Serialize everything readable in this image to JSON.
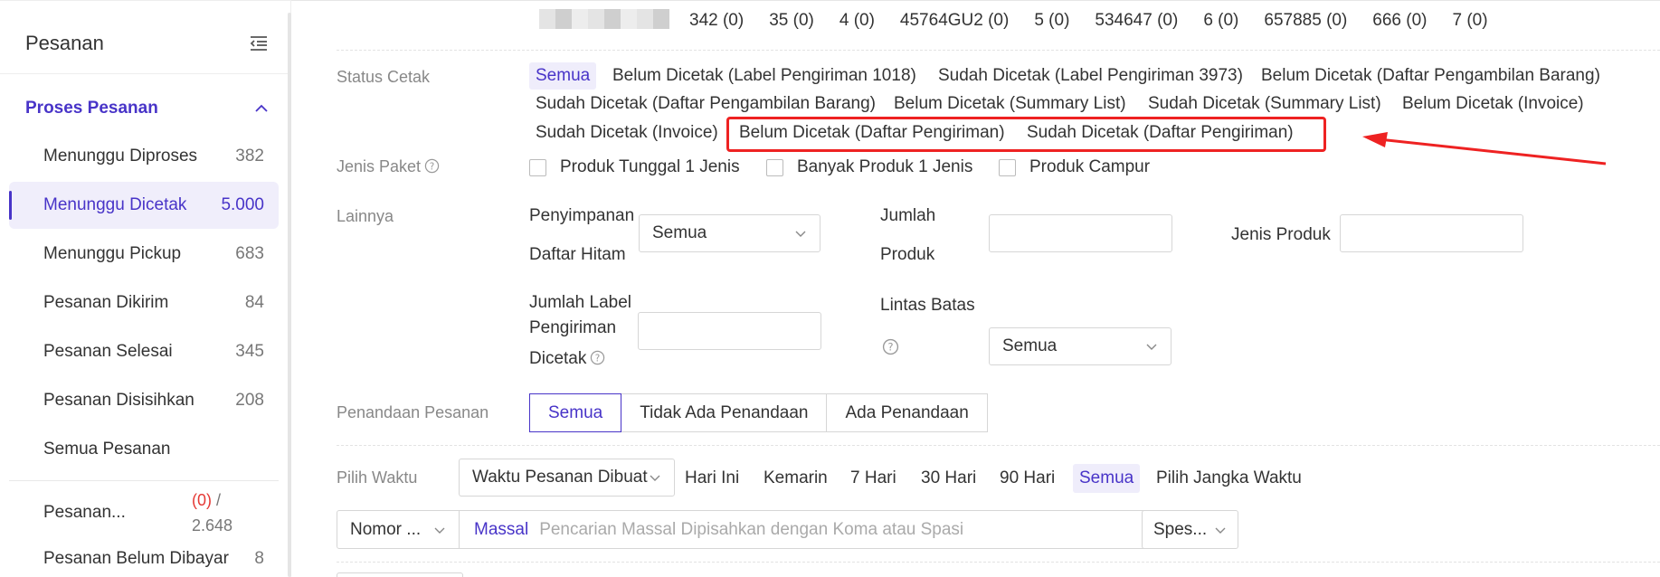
{
  "sidebar": {
    "title": "Pesanan",
    "group_label": "Proses Pesanan",
    "items": [
      {
        "label": "Menunggu Diproses",
        "count": "382"
      },
      {
        "label": "Menunggu Dicetak",
        "count": "5.000"
      },
      {
        "label": "Menunggu Pickup",
        "count": "683"
      },
      {
        "label": "Pesanan Dikirim",
        "count": "84"
      },
      {
        "label": "Pesanan Selesai",
        "count": "345"
      },
      {
        "label": "Pesanan Disisihkan",
        "count": "208"
      },
      {
        "label": "Semua Pesanan",
        "count": ""
      }
    ],
    "extra": {
      "label": "Pesanan...",
      "count_red": "(0)",
      "count_sep": " /",
      "count_total": "2.648"
    },
    "last": {
      "label": "Pesanan Belum Dibayar",
      "count": "8"
    }
  },
  "top_counts": [
    "342 (0)",
    "35 (0)",
    "4 (0)",
    "45764GU2 (0)",
    "5 (0)",
    "534647 (0)",
    "6 (0)",
    "657885 (0)",
    "666 (0)",
    "7 (0)"
  ],
  "status_cetak": {
    "label": "Status Cetak",
    "options": [
      "Semua",
      "Belum Dicetak (Label Pengiriman 1018)",
      "Sudah Dicetak (Label Pengiriman 3973)",
      "Belum Dicetak (Daftar Pengambilan Barang)",
      "Sudah Dicetak (Daftar Pengambilan Barang)",
      "Belum Dicetak (Summary List)",
      "Sudah Dicetak (Summary List)",
      "Belum Dicetak (Invoice)",
      "Sudah Dicetak (Invoice)",
      "Belum Dicetak (Daftar Pengiriman)",
      "Sudah Dicetak (Daftar Pengiriman)"
    ]
  },
  "jenis_paket": {
    "label": "Jenis Paket",
    "options": [
      "Produk Tunggal 1 Jenis",
      "Banyak Produk 1 Jenis",
      "Produk Campur"
    ]
  },
  "lainnya": {
    "label": "Lainnya",
    "penyimpanan_line1": "Penyimpanan",
    "penyimpanan_line2": "Daftar Hitam",
    "penyimpanan_value": "Semua",
    "jumlah_line1": "Jumlah",
    "jumlah_line2": "Produk",
    "jenis_produk": "Jenis Produk",
    "label_line1": "Jumlah Label",
    "label_line2": "Pengiriman",
    "label_line3": "Dicetak",
    "lintas_batas": "Lintas Batas",
    "lintas_value": "Semua"
  },
  "penandaan": {
    "label": "Penandaan Pesanan",
    "options": [
      "Semua",
      "Tidak Ada Penandaan",
      "Ada Penandaan"
    ]
  },
  "waktu": {
    "label": "Pilih Waktu",
    "type": "Waktu Pesanan Dibuat",
    "options": [
      "Hari Ini",
      "Kemarin",
      "7 Hari",
      "30 Hari",
      "90 Hari",
      "Semua",
      "Pilih Jangka Waktu"
    ]
  },
  "search": {
    "type": "Nomor ...",
    "massal": "Massal",
    "placeholder": "Pencarian Massal Dipisahkan dengan Koma atau Spasi",
    "spes": "Spes..."
  },
  "colors": {
    "accent": "#4834c8",
    "highlight": "#ee2222"
  }
}
